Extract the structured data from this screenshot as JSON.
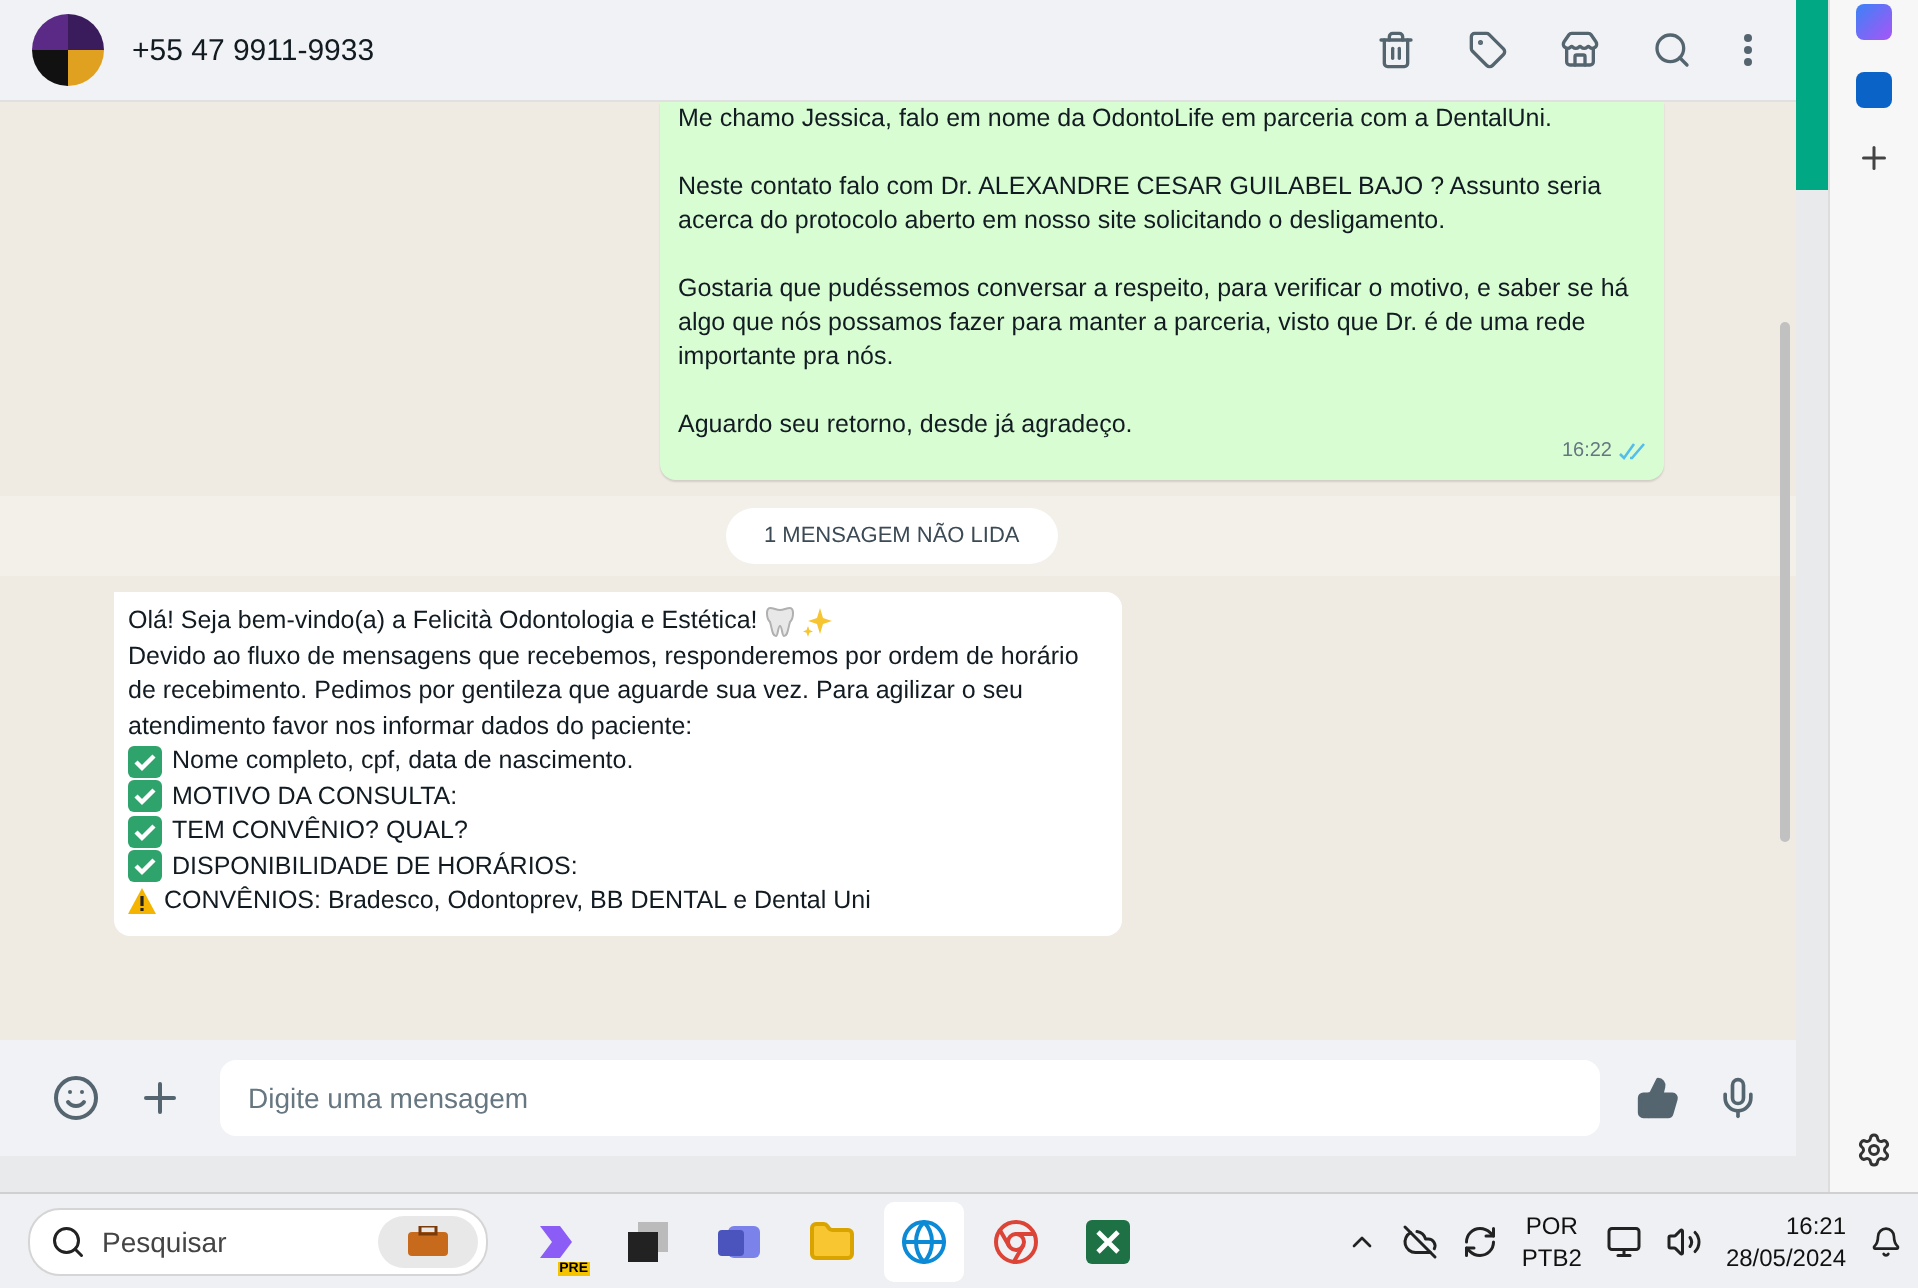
{
  "header": {
    "contact": "+55 47 9911-9933"
  },
  "outgoing": {
    "paragraphs": [
      "Me chamo Jessica, falo em nome da OdontoLife em parceria com a DentalUni.",
      "Neste contato falo com Dr. ALEXANDRE CESAR GUILABEL BAJO ? Assunto seria acerca do protocolo aberto em nosso site solicitando o desligamento.",
      "Gostaria que pudéssemos conversar a respeito, para verificar o motivo, e saber se há algo que nós possamos fazer para manter a parceria, visto que Dr. é de uma rede importante pra nós.",
      "Aguardo seu retorno, desde já agradeço."
    ],
    "time": "16:22",
    "read": true
  },
  "unread_banner": "1 MENSAGEM NÃO LIDA",
  "incoming": {
    "greeting": "Olá! Seja bem-vindo(a) a Felicità Odontologia e Estética!",
    "body": "Devido ao fluxo de mensagens que recebemos, responderemos  por ordem de horário de recebimento. Pedimos por gentileza que aguarde sua vez.  Para agilizar o seu atendimento favor nos informar dados do paciente:",
    "items": [
      {
        "kind": "check",
        "text": "Nome completo, cpf, data de nascimento."
      },
      {
        "kind": "check",
        "text": "MOTIVO DA CONSULTA:"
      },
      {
        "kind": "check",
        "text": "TEM CONVÊNIO? QUAL?"
      },
      {
        "kind": "check",
        "text": "DISPONIBILIDADE DE HORÁRIOS:"
      },
      {
        "kind": "warning",
        "text": "CONVÊNIOS: Bradesco, Odontoprev, BB DENTAL e Dental Uni"
      }
    ]
  },
  "composer": {
    "placeholder": "Digite uma mensagem"
  },
  "taskbar": {
    "search_placeholder": "Pesquisar",
    "copilot_badge": "PRE",
    "language": "POR",
    "layout": "PTB2",
    "time": "16:21",
    "date": "28/05/2024"
  }
}
